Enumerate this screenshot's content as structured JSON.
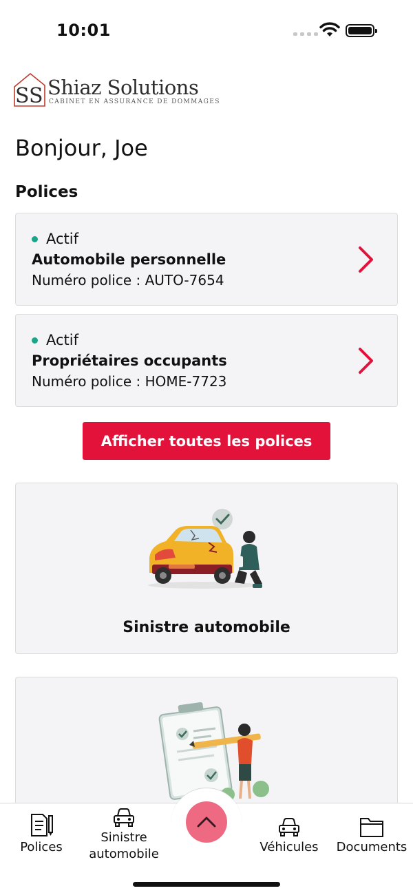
{
  "status_bar": {
    "time": "10:01"
  },
  "brand": {
    "name": "Shiaz Solutions",
    "tagline": "CABINET EN ASSURANCE DE DOMMAGES",
    "monogram": "SS"
  },
  "greeting": "Bonjour, Joe",
  "policies_section": {
    "title": "Polices",
    "items": [
      {
        "status": "Actif",
        "title": "Automobile personnelle",
        "number": "Numéro police : AUTO-7654"
      },
      {
        "status": "Actif",
        "title": "Propriétaires occupants",
        "number": "Numéro police : HOME-7723"
      }
    ],
    "show_all_label": "Afficher toutes les polices"
  },
  "feature_cards": [
    {
      "label": "Sinistre automobile",
      "icon": "car-damage-illustration"
    },
    {
      "label": "",
      "icon": "checklist-illustration"
    }
  ],
  "tabbar": {
    "items": [
      {
        "label": "Polices",
        "icon": "document-pencil-icon"
      },
      {
        "label": "Sinistre automobile",
        "icon": "car-icon"
      },
      {
        "label": "Véhicules",
        "icon": "car-icon"
      },
      {
        "label": "Documents",
        "icon": "folder-icon"
      }
    ],
    "center_icon": "chevron-up-icon"
  },
  "colors": {
    "accent": "#e2123a",
    "status_active": "#1aa68a",
    "fab": "#ee6a82",
    "card_bg": "#f4f4f6"
  }
}
